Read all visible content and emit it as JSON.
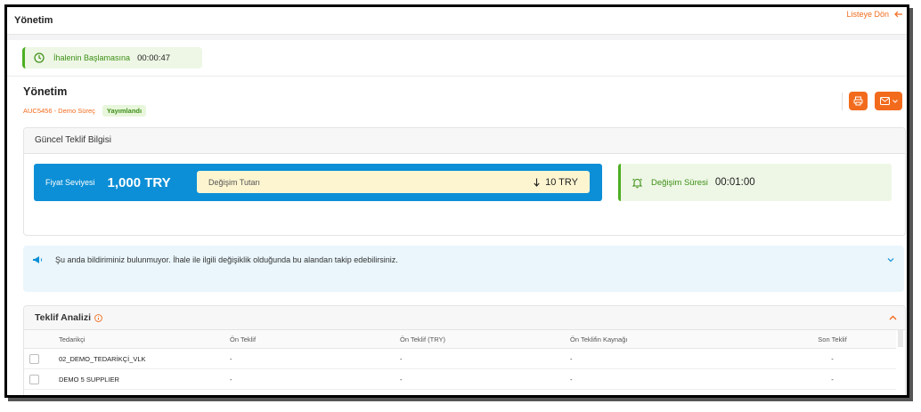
{
  "topbar": {
    "title": "Yönetim",
    "back_label": "Listeye Dön"
  },
  "timer": {
    "label": "İhalenin Başlamasına",
    "value": "00:00:47"
  },
  "auction": {
    "title": "Yönetim",
    "code": "AUC5456 - Demo Süreç",
    "status": "Yayımlandı"
  },
  "current_offer": {
    "header": "Güncel Teklif Bilgisi",
    "price_label": "Fiyat Seviyesi",
    "price_value": "1,000 TRY",
    "change_label": "Değişim Tutarı",
    "change_value": "10 TRY",
    "duration_label": "Değişim Süresi",
    "duration_value": "00:01:00"
  },
  "notice": {
    "text": "Şu anda bildiriminiz bulunmuyor. İhale ile ilgili değişiklik olduğunda bu alandan takip edebilirsiniz."
  },
  "analysis": {
    "title": "Teklif Analizi",
    "columns": [
      "Tedarikçi",
      "Ön Teklif",
      "Ön Teklif (TRY)",
      "Ön Teklifin Kaynağı",
      "Son Teklif"
    ],
    "rows": [
      [
        "02_DEMO_TEDARİKÇİ_VLK",
        "-",
        "-",
        "-",
        "-"
      ],
      [
        "DEMO 5 SUPPLIER",
        "-",
        "-",
        "-",
        "-"
      ]
    ]
  },
  "colors": {
    "accent": "#f26b1d",
    "primary": "#0c8fd6",
    "success": "#4caf22",
    "highlight": "#fdf5d0"
  },
  "icons": [
    "back-arrow-icon",
    "clock-icon",
    "print-icon",
    "mail-icon",
    "chevron-down-icon",
    "bell-icon",
    "megaphone-icon",
    "arrow-down-icon",
    "info-icon",
    "chevron-up-icon"
  ]
}
